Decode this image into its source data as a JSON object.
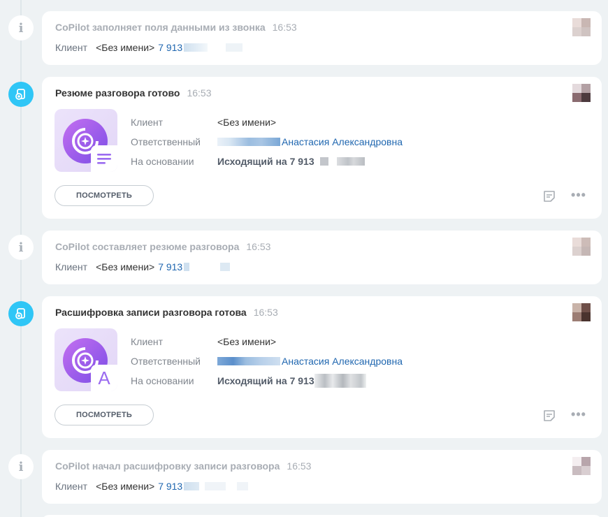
{
  "events": [
    {
      "title": "CoPilot заполняет поля данными из звонка",
      "time": "16:53",
      "client_label": "Клиент",
      "client_name": "<Без имени>",
      "phone": "7 913"
    },
    {
      "title": "Резюме разговора готово",
      "time": "16:53",
      "client_label": "Клиент",
      "client_value": "<Без имени>",
      "responsible_label": "Ответственный",
      "responsible_name": "Анастасия Александровна",
      "basis_label": "На основании",
      "basis_value": "Исходящий на 7 913",
      "view_button": "ПОСМОТРЕТЬ",
      "icon": "summary-document-icon"
    },
    {
      "title": "CoPilot составляет резюме разговора",
      "time": "16:53",
      "client_label": "Клиент",
      "client_name": "<Без имени>",
      "phone": "7 913"
    },
    {
      "title": "Расшифровка записи разговора готова",
      "time": "16:53",
      "client_label": "Клиент",
      "client_value": "<Без имени>",
      "responsible_label": "Ответственный",
      "responsible_name": "Анастасия Александровна",
      "basis_label": "На основании",
      "basis_value": "Исходящий на 7 913",
      "view_button": "ПОСМОТРЕТЬ",
      "icon": "transcript-letter-icon",
      "badge_letter": "A"
    },
    {
      "title": "CoPilot начал расшифровку записи разговора",
      "time": "16:53",
      "client_label": "Клиент",
      "client_name": "<Без имени>",
      "phone": "7 913"
    }
  ],
  "colors": {
    "accent": "#2fc6f6",
    "link": "#2067b0",
    "copilot_gradient_start": "#c46ff0",
    "copilot_gradient_end": "#7b4ee6"
  }
}
